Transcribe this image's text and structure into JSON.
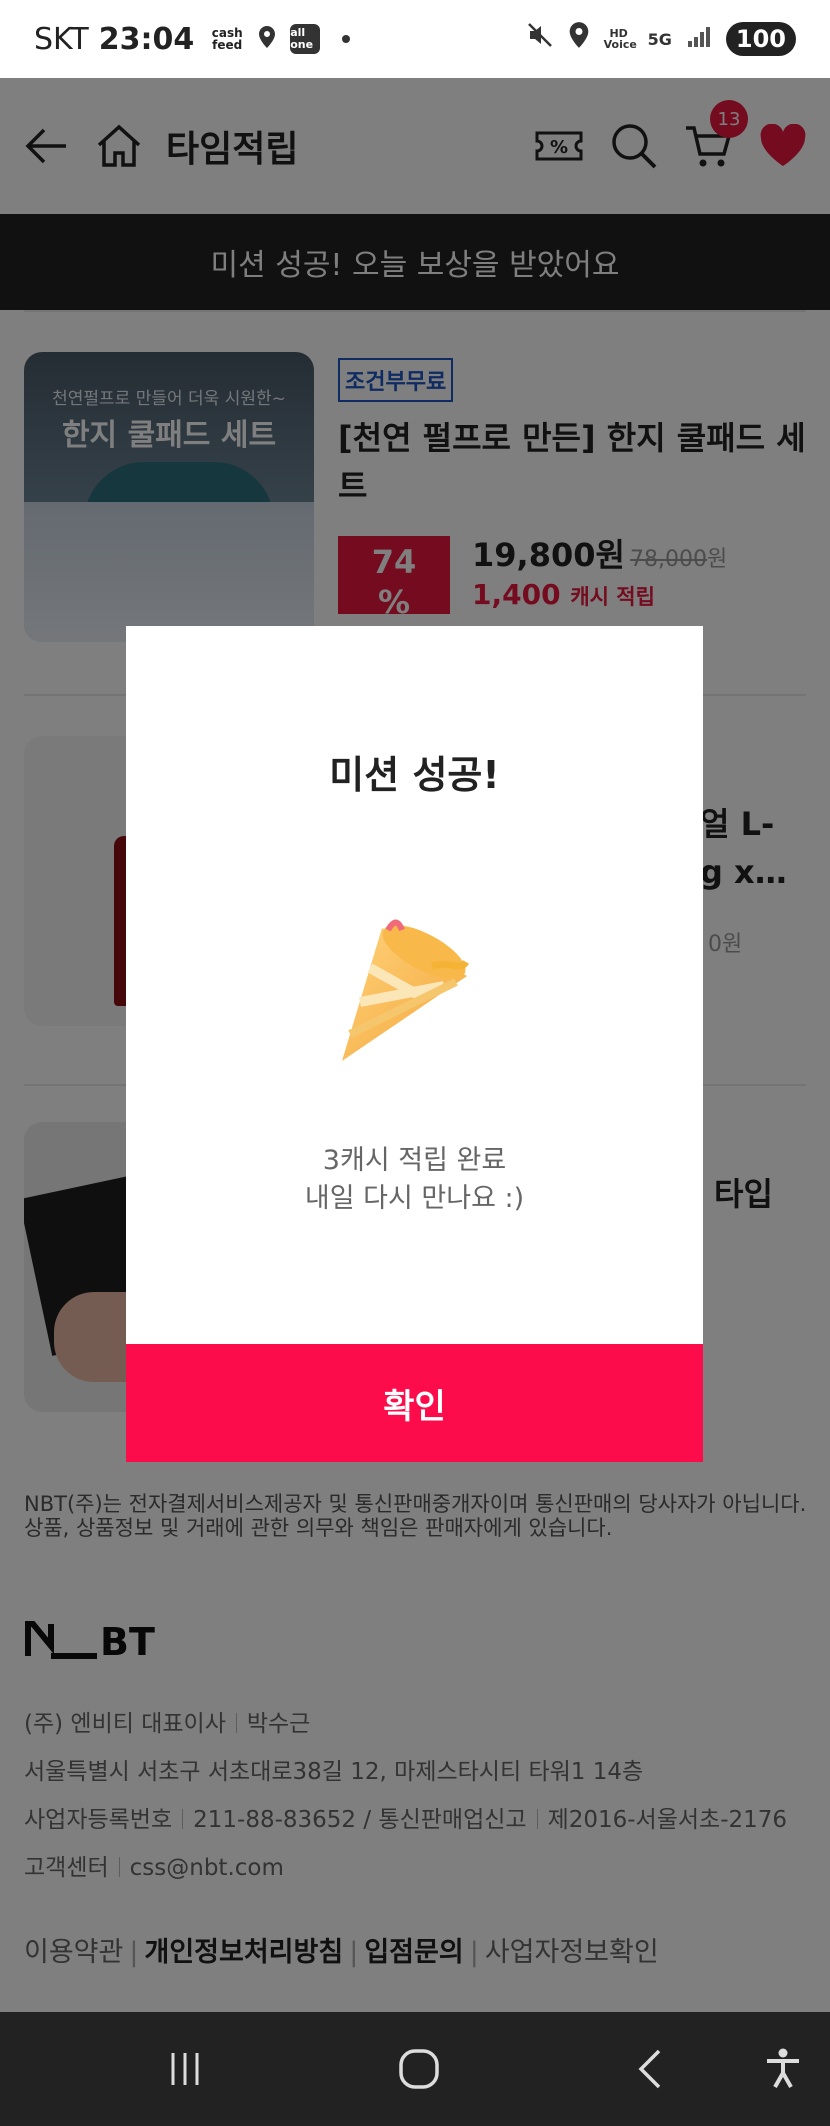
{
  "status_bar": {
    "carrier": "SKT",
    "time": "23:04",
    "app_badge_1": "cash feed",
    "app_badge_2": "all one",
    "hd_label": "HD Voice",
    "net_label": "5G",
    "battery": "100"
  },
  "header": {
    "title": "타임적립",
    "cart_count": "13",
    "coupon_symbol": "%"
  },
  "banner": {
    "text": "미션 성공! 오늘 보상을 받았어요"
  },
  "products": [
    {
      "badge": "조건부무료",
      "name": "[천연 펄프로 만든] 한지 쿨패드 세트",
      "sale_price": "19,800원",
      "original_price": "78,000",
      "original_unit": "원",
      "cash_amount": "1,400",
      "cash_label": "캐시 적립",
      "discount_num": "74",
      "discount_pct": "%",
      "thumb_line1": "천연펄프로 만들어 더욱 시원한~",
      "thumb_line2": "한지 쿨패드 세트"
    },
    {
      "name_partial_1": "얼 L-",
      "name_partial_2": "g x…",
      "price_partial": "0원"
    },
    {
      "name_partial": "타입"
    }
  ],
  "modal": {
    "title": "미션 성공!",
    "message_line1": "3캐시 적립 완료",
    "message_line2": "내일 다시 만나요 :)",
    "confirm_label": "확인"
  },
  "footer": {
    "disclaimer": "NBT(주)는 전자결제서비스제공자 및 통신판매중개자이며 통신판매의 당사자가 아닙니다. 상품, 상품정보 및 거래에 관한 의무와 책임은 판매자에게 있습니다.",
    "logo_text": "NBT",
    "company": "(주) 엔비티 대표이사",
    "ceo": "박수근",
    "address": "서울특별시 서초구 서초대로38길 12, 마제스타시티 타워1 14층",
    "biz_reg_label": "사업자등록번호",
    "biz_reg_value": "211-88-83652 / 통신판매업신고",
    "ecommerce_no": "제2016-서울서초-2176",
    "cs_label": "고객센터",
    "cs_email": "css@nbt.com",
    "links": [
      {
        "label": "이용약관",
        "bold": false
      },
      {
        "label": "개인정보처리방침",
        "bold": true
      },
      {
        "label": "입점문의",
        "bold": true
      },
      {
        "label": "사업자정보확인",
        "bold": false
      }
    ]
  },
  "colors": {
    "accent": "#fc0c4a",
    "badge_blue": "#1d57c4",
    "banner_bg": "#222222"
  }
}
